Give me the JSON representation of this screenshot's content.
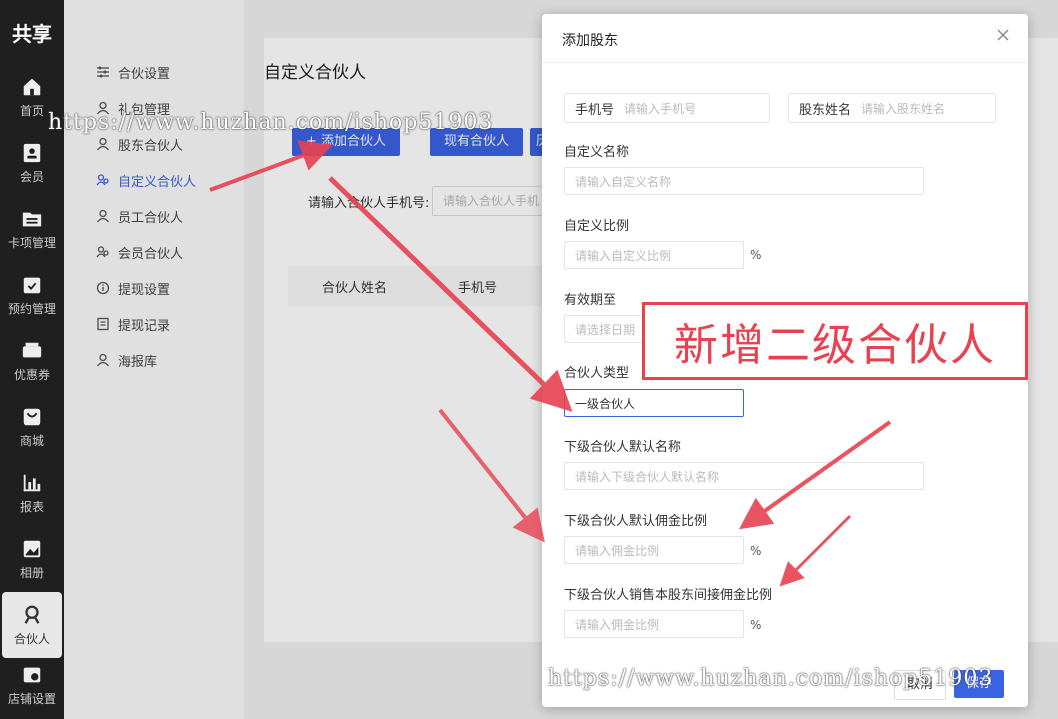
{
  "rail": {
    "logo": "共享",
    "items": [
      {
        "label": "首页",
        "icon": "home-icon"
      },
      {
        "label": "会员",
        "icon": "member-card-icon"
      },
      {
        "label": "卡项管理",
        "icon": "folder-icon"
      },
      {
        "label": "预约管理",
        "icon": "calendar-check-icon"
      },
      {
        "label": "优惠券",
        "icon": "coupon-icon"
      },
      {
        "label": "商城",
        "icon": "bag-icon"
      },
      {
        "label": "报表",
        "icon": "bar-chart-icon"
      },
      {
        "label": "相册",
        "icon": "image-icon"
      },
      {
        "label": "合伙人",
        "icon": "partner-icon"
      },
      {
        "label": "店铺设置",
        "icon": "shop-settings-icon"
      }
    ]
  },
  "submenu": {
    "items": [
      {
        "label": "合伙设置",
        "icon": "sliders-icon"
      },
      {
        "label": "礼包管理",
        "icon": "user-icon"
      },
      {
        "label": "股东合伙人",
        "icon": "user-icon"
      },
      {
        "label": "自定义合伙人",
        "icon": "user-group-icon"
      },
      {
        "label": "员工合伙人",
        "icon": "user-icon"
      },
      {
        "label": "会员合伙人",
        "icon": "user-group-icon"
      },
      {
        "label": "提现设置",
        "icon": "info-circle-icon"
      },
      {
        "label": "提现记录",
        "icon": "document-icon"
      },
      {
        "label": "海报库",
        "icon": "user-icon"
      }
    ]
  },
  "main": {
    "title": "自定义合伙人",
    "add_button": "+ 添加合伙人",
    "existing_button": "现有合伙人",
    "more_button": "历",
    "filter_label": "请输入合伙人手机号:",
    "filter_placeholder": "请输入合伙人手机",
    "table_headers": [
      "合伙人姓名",
      "手机号"
    ]
  },
  "modal": {
    "title": "添加股东",
    "phone": {
      "label": "手机号",
      "placeholder": "请输入手机号"
    },
    "holder_name": {
      "label": "股东姓名",
      "placeholder": "请输入股东姓名"
    },
    "custom_name": {
      "label": "自定义名称",
      "placeholder": "请输入自定义名称"
    },
    "custom_ratio": {
      "label": "自定义比例",
      "placeholder": "请输入自定义比例",
      "unit": "%"
    },
    "valid_until": {
      "label": "有效期至",
      "placeholder": "请选择日期"
    },
    "partner_type": {
      "label": "合伙人类型",
      "value": "一级合伙人"
    },
    "sub_default_name": {
      "label": "下级合伙人默认名称",
      "placeholder": "请输入下级合伙人默认名称"
    },
    "sub_commission": {
      "label": "下级合伙人默认佣金比例",
      "placeholder": "请输入佣金比例",
      "unit": "%"
    },
    "sub_indirect": {
      "label": "下级合伙人销售本股东间接佣金比例",
      "placeholder": "请输入佣金比例",
      "unit": "%"
    },
    "cancel": "取消",
    "save": "保存"
  },
  "annotation": "新增二级合伙人",
  "watermark": "https://www.huzhan.com/ishop51903",
  "colors": {
    "accent": "#3a63e3",
    "annotation": "#e8414f"
  }
}
